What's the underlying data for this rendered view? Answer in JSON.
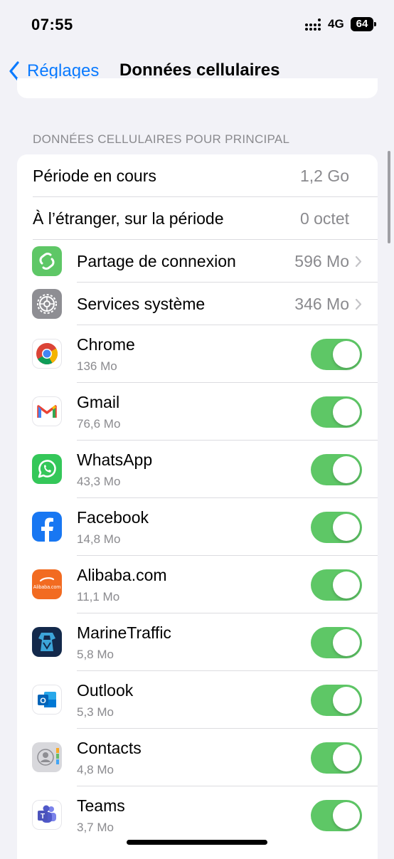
{
  "status_bar": {
    "time": "07:55",
    "network": "4G",
    "battery": "64"
  },
  "nav": {
    "back_label": "Réglages",
    "title": "Données cellulaires"
  },
  "section_header": "DONNÉES CELLULAIRES POUR PRINCIPAL",
  "summary_rows": [
    {
      "label": "Période en cours",
      "value": "1,2 Go"
    },
    {
      "label": "À l’étranger, sur la période",
      "value": "0 octet"
    }
  ],
  "detail_rows": [
    {
      "label": "Partage de connexion",
      "value": "596 Mo",
      "icon": "hotspot-icon",
      "color": "#5ec766"
    },
    {
      "label": "Services système",
      "value": "346 Mo",
      "icon": "gear-icon",
      "color": "#8e8e93"
    }
  ],
  "apps": [
    {
      "name": "Chrome",
      "size": "136 Mo",
      "icon": "chrome-icon",
      "enabled": true
    },
    {
      "name": "Gmail",
      "size": "76,6 Mo",
      "icon": "gmail-icon",
      "enabled": true
    },
    {
      "name": "WhatsApp",
      "size": "43,3 Mo",
      "icon": "whatsapp-icon",
      "enabled": true
    },
    {
      "name": "Facebook",
      "size": "14,8 Mo",
      "icon": "facebook-icon",
      "enabled": true
    },
    {
      "name": "Alibaba.com",
      "size": "11,1 Mo",
      "icon": "alibaba-icon",
      "icon_text": "Alibaba.com",
      "enabled": true
    },
    {
      "name": "MarineTraffic",
      "size": "5,8 Mo",
      "icon": "marinetraffic-icon",
      "enabled": true
    },
    {
      "name": "Outlook",
      "size": "5,3 Mo",
      "icon": "outlook-icon",
      "icon_text": "O",
      "enabled": true
    },
    {
      "name": "Contacts",
      "size": "4,8 Mo",
      "icon": "contacts-icon",
      "enabled": true
    },
    {
      "name": "Teams",
      "size": "3,7 Mo",
      "icon": "teams-icon",
      "icon_text": "T",
      "enabled": true
    }
  ],
  "colors": {
    "accent": "#0a7aff",
    "toggle_on": "#5ec766",
    "secondary_text": "#8a8a8e"
  }
}
